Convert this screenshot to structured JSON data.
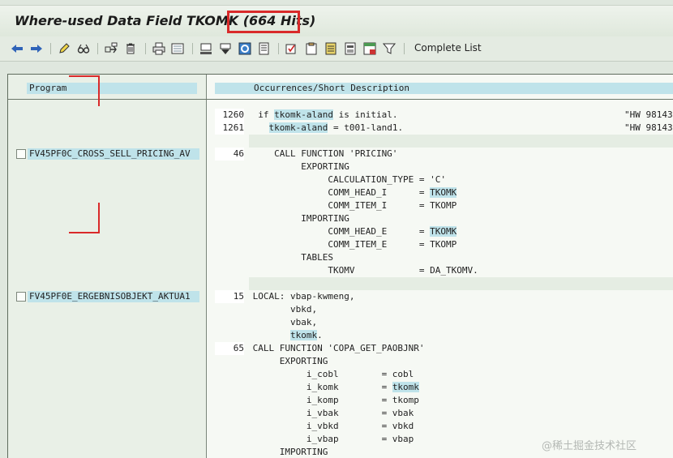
{
  "title": {
    "prefix": "Where-used Data Field TKOMK",
    "hits": "(664 Hits)"
  },
  "toolbar": {
    "buttons": [
      {
        "name": "back-arrow-icon"
      },
      {
        "name": "forward-arrow-icon"
      },
      {
        "name": "pencil-icon"
      },
      {
        "name": "glasses-icon"
      },
      {
        "name": "where-used-icon"
      },
      {
        "name": "trash-icon"
      },
      {
        "name": "print-icon"
      },
      {
        "name": "list-icon"
      },
      {
        "name": "find-icon"
      },
      {
        "name": "find-next-icon"
      },
      {
        "name": "refresh-icon"
      },
      {
        "name": "doc-icon"
      },
      {
        "name": "select-icon"
      },
      {
        "name": "clipboard-icon"
      },
      {
        "name": "export-icon"
      },
      {
        "name": "layout-icon"
      },
      {
        "name": "spreadsheet-icon"
      },
      {
        "name": "filter-icon"
      }
    ],
    "complete_list": "Complete List"
  },
  "columns": {
    "program": "Program",
    "occurrences": "Occurrences/Short Description"
  },
  "programs": [
    {
      "name": "FV45PF0C_CROSS_SELL_PRICING_AV"
    },
    {
      "name": "FV45PF0E_ERGEBNISOBJEKT_AKTUA1"
    }
  ],
  "code": [
    {
      "ln": "1260",
      "parts": [
        {
          "t": "  if "
        },
        {
          "t": "tkomk-aland",
          "hl": true
        },
        {
          "t": " is initial."
        }
      ],
      "cm": "\"HW 98143"
    },
    {
      "ln": "1261",
      "parts": [
        {
          "t": "    "
        },
        {
          "t": "tkomk-aland",
          "hl": true
        },
        {
          "t": " = t001-land1."
        }
      ],
      "cm": "\"HW 98143"
    },
    {
      "gap": true
    },
    {
      "ln": "46",
      "parts": [
        {
          "t": "     CALL FUNCTION 'PRICING'"
        }
      ]
    },
    {
      "parts": [
        {
          "t": "          EXPORTING"
        }
      ]
    },
    {
      "parts": [
        {
          "t": "               CALCULATION_TYPE = 'C'"
        }
      ]
    },
    {
      "parts": [
        {
          "t": "               COMM_HEAD_I      = "
        },
        {
          "t": "TKOMK",
          "hl": true
        }
      ]
    },
    {
      "parts": [
        {
          "t": "               COMM_ITEM_I      = TKOMP"
        }
      ]
    },
    {
      "parts": [
        {
          "t": "          IMPORTING"
        }
      ]
    },
    {
      "parts": [
        {
          "t": "               COMM_HEAD_E      = "
        },
        {
          "t": "TKOMK",
          "hl": true
        }
      ]
    },
    {
      "parts": [
        {
          "t": "               COMM_ITEM_E      = TKOMP"
        }
      ]
    },
    {
      "parts": [
        {
          "t": "          TABLES"
        }
      ]
    },
    {
      "parts": [
        {
          "t": "               TKOMV            = DA_TKOMV."
        }
      ]
    },
    {
      "gap": true
    },
    {
      "ln": "15",
      "parts": [
        {
          "t": " LOCAL: vbap-kwmeng,"
        }
      ]
    },
    {
      "parts": [
        {
          "t": "        vbkd,"
        }
      ]
    },
    {
      "parts": [
        {
          "t": "        vbak,"
        }
      ]
    },
    {
      "parts": [
        {
          "t": "        "
        },
        {
          "t": "tkomk",
          "hl": true
        },
        {
          "t": "."
        }
      ]
    },
    {
      "ln": "65",
      "parts": [
        {
          "t": " CALL FUNCTION 'COPA_GET_PAOBJNR'"
        }
      ]
    },
    {
      "parts": [
        {
          "t": "      EXPORTING"
        }
      ]
    },
    {
      "parts": [
        {
          "t": "           i_cobl        = cobl"
        }
      ]
    },
    {
      "parts": [
        {
          "t": "           i_komk        = "
        },
        {
          "t": "tkomk",
          "hl": true
        }
      ]
    },
    {
      "parts": [
        {
          "t": "           i_komp        = tkomp"
        }
      ]
    },
    {
      "parts": [
        {
          "t": "           i_vbak        = vbak"
        }
      ]
    },
    {
      "parts": [
        {
          "t": "           i_vbkd        = vbkd"
        }
      ]
    },
    {
      "parts": [
        {
          "t": "           i_vbap        = vbap"
        }
      ]
    },
    {
      "parts": [
        {
          "t": "      IMPORTING"
        }
      ]
    }
  ],
  "watermark": "@稀土掘金技术社区",
  "colors": {
    "highlight": "#bfe3ea",
    "annotation_red": "#d92a2a",
    "background": "#dfe7de"
  }
}
